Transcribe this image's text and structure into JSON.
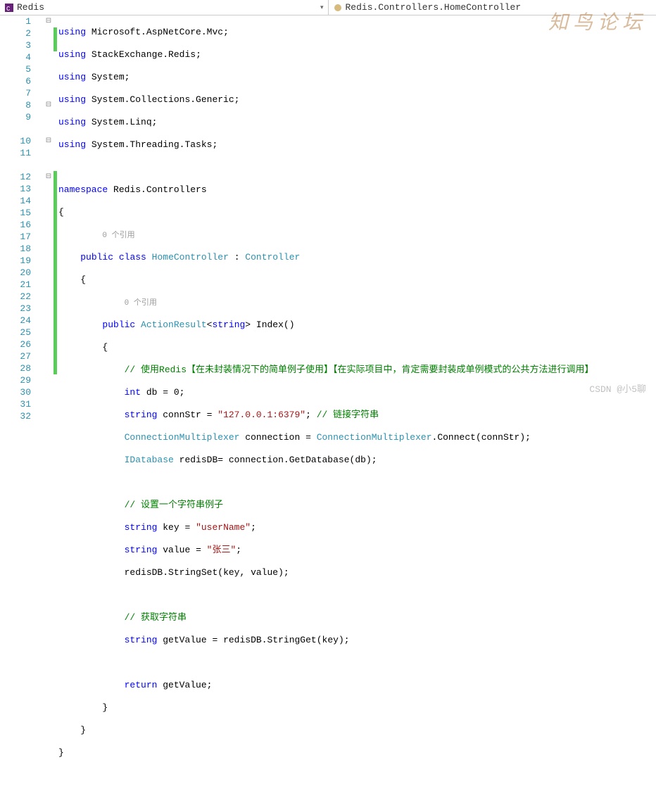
{
  "topbar": {
    "left": {
      "icon": "csharp-project-icon",
      "text": "Redis"
    },
    "right": {
      "icon": "class-icon",
      "text": "Redis.Controllers.HomeController"
    }
  },
  "watermarks": {
    "logo": "知 鸟 论 坛",
    "csdn": "CSDN @小5聊"
  },
  "references": {
    "zero": "0 个引用"
  },
  "code": {
    "using1": {
      "kw": "using",
      "ns": "Microsoft.AspNetCore.Mvc"
    },
    "using2": {
      "kw": "using",
      "ns": "StackExchange.Redis"
    },
    "using3": {
      "kw": "using",
      "ns": "System"
    },
    "using4": {
      "kw": "using",
      "ns": "System.Collections.Generic"
    },
    "using5": {
      "kw": "using",
      "ns": "System.Linq"
    },
    "using6": {
      "kw": "using",
      "ns": "System.Threading.Tasks"
    },
    "ns_kw": "namespace",
    "ns_name": "Redis.Controllers",
    "class_kw1": "public",
    "class_kw2": "class",
    "class_name": "HomeController",
    "class_base": "Controller",
    "method_kw": "public",
    "method_ret": "ActionResult",
    "method_gen": "string",
    "method_name": "Index",
    "comment1": "// 使用Redis【在未封装情况下的简单例子使用】【在实际项目中，肯定需要封装成单例模式的公共方法进行调用】",
    "int_kw": "int",
    "db_var": "db",
    "db_val": "0",
    "str_kw": "string",
    "conn_var": "connStr",
    "conn_val": "\"127.0.0.1:6379\"",
    "conn_comment": "// 链接字符串",
    "cm_type": "ConnectionMultiplexer",
    "cm_var": "connection",
    "cm_method": "Connect",
    "cm_arg": "connStr",
    "idb_type": "IDatabase",
    "idb_var": "redisDB",
    "idb_src": "connection",
    "idb_method": "GetDatabase",
    "idb_arg": "db",
    "comment2": "// 设置一个字符串例子",
    "key_var": "key",
    "key_val": "\"userName\"",
    "val_var": "value",
    "val_val": "\"张三\"",
    "set_obj": "redisDB",
    "set_method": "StringSet",
    "set_args": "key, value",
    "comment3": "// 获取字符串",
    "get_var": "getValue",
    "get_obj": "redisDB",
    "get_method": "StringGet",
    "get_arg": "key",
    "return_kw": "return",
    "return_val": "getValue"
  },
  "lines": [
    "1",
    "2",
    "3",
    "4",
    "5",
    "6",
    "7",
    "8",
    "9",
    "",
    "10",
    "11",
    "",
    "12",
    "13",
    "14",
    "15",
    "16",
    "17",
    "18",
    "19",
    "20",
    "21",
    "22",
    "23",
    "24",
    "25",
    "26",
    "27",
    "28",
    "29",
    "30",
    "31",
    "32"
  ]
}
